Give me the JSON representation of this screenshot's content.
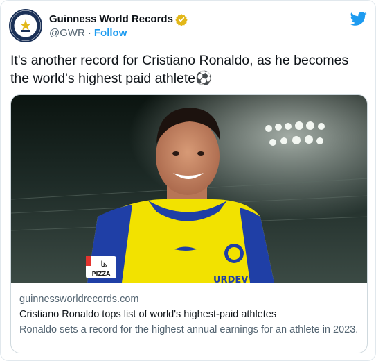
{
  "header": {
    "display_name": "Guinness World Records",
    "handle": "@GWR",
    "separator": "·",
    "follow_label": "Follow"
  },
  "tweet": {
    "text": "It's another record for Cristiano Ronaldo, as he becomes the world's highest paid athlete⚽"
  },
  "card": {
    "domain": "guinnessworldrecords.com",
    "title": "Cristiano Ronaldo tops list of world's highest-paid athletes",
    "description": "Ronaldo sets a record for the highest annual earnings for an athlete in 2023.",
    "image_text": {
      "sponsor_top": "ها",
      "sponsor_bottom": "PIZZA",
      "shirt_text": "URDEV"
    }
  },
  "icons": {
    "avatar": "guinness-logo-icon",
    "verified": "verified-badge-icon",
    "platform": "twitter-bird-icon"
  },
  "colors": {
    "accent": "#1d9bf0",
    "verified_gold": "#e2b719",
    "jersey_yellow": "#f2e200",
    "jersey_blue": "#1f3fa6"
  }
}
